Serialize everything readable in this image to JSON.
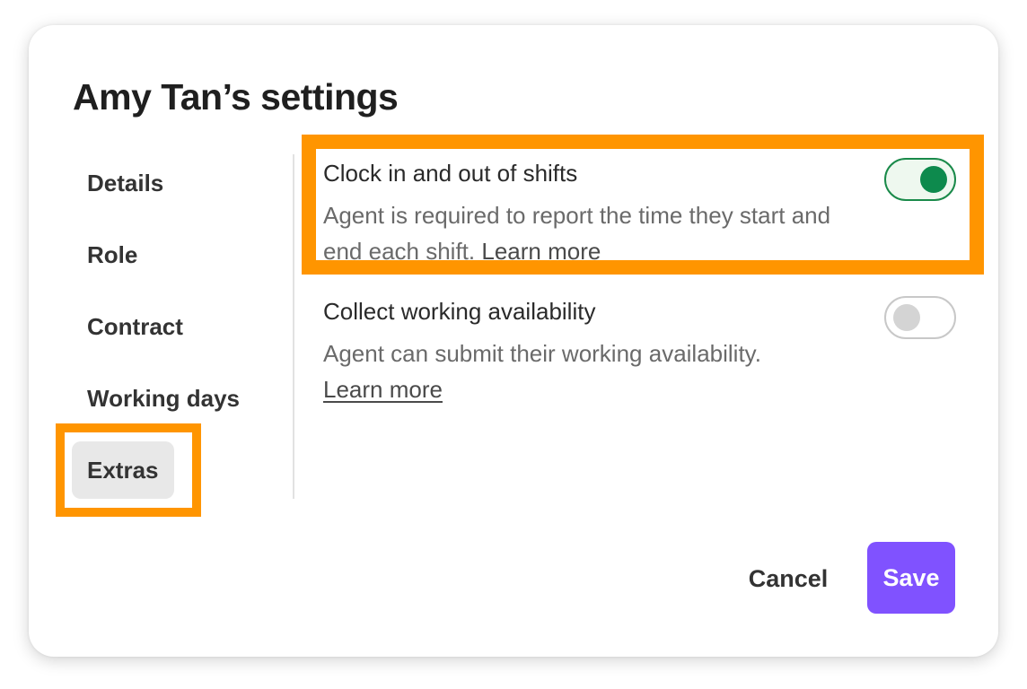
{
  "dialog": {
    "title": "Amy Tan’s settings"
  },
  "sidebar": {
    "items": [
      {
        "label": "Details"
      },
      {
        "label": "Role"
      },
      {
        "label": "Contract"
      },
      {
        "label": "Working days"
      },
      {
        "label": "Extras"
      }
    ],
    "active_item": "Extras"
  },
  "settings": [
    {
      "title": "Clock in and out of shifts",
      "description": "Agent is required to report the time they start and end each shift.",
      "link": "Learn more",
      "toggle_on": true
    },
    {
      "title": "Collect working availability",
      "description": "Agent can submit their working availability.",
      "link": "Learn more",
      "toggle_on": false
    }
  ],
  "footer": {
    "cancel_label": "Cancel",
    "save_label": "Save"
  },
  "colors": {
    "accent_purple": "#8052ff",
    "toggle_on_green": "#0d8a4d",
    "highlight_orange": "#ff9500"
  }
}
